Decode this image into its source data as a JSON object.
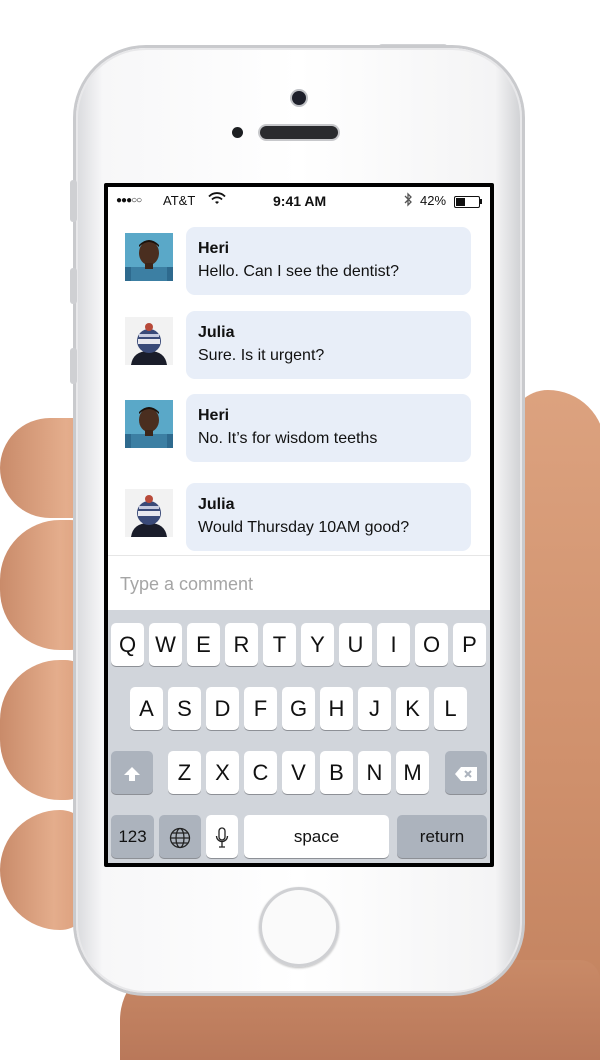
{
  "status_bar": {
    "signal": "●●●○○",
    "carrier": "AT&T",
    "time": "9:41 AM",
    "battery_percent": "42%",
    "battery_level": 0.42
  },
  "messages": [
    {
      "name": "Heri",
      "text": "Hello. Can I see the dentist?",
      "avatar": "heri-avatar"
    },
    {
      "name": "Julia",
      "text": "Sure. Is it urgent?",
      "avatar": "julia-avatar"
    },
    {
      "name": "Heri",
      "text": "No. It’s for wisdom teeths",
      "avatar": "heri-avatar"
    },
    {
      "name": "Julia",
      "text": "Would Thursday 10AM good?",
      "avatar": "julia-avatar"
    }
  ],
  "comment": {
    "placeholder": "Type a comment",
    "value": ""
  },
  "keyboard": {
    "row1": [
      "Q",
      "W",
      "E",
      "R",
      "T",
      "Y",
      "U",
      "I",
      "O",
      "P"
    ],
    "row2": [
      "A",
      "S",
      "D",
      "F",
      "G",
      "H",
      "J",
      "K",
      "L"
    ],
    "row3": [
      "Z",
      "X",
      "C",
      "V",
      "B",
      "N",
      "M"
    ],
    "shift_icon": "shift-arrow-icon",
    "delete_icon": "backspace-icon",
    "numbers_label": "123",
    "globe_icon": "globe-icon",
    "mic_icon": "microphone-icon",
    "space_label": "space",
    "return_label": "return"
  },
  "colors": {
    "bubble": "#e8eef8",
    "keyboard_bg": "#d1d5db",
    "key_gray": "#acb3bd"
  }
}
